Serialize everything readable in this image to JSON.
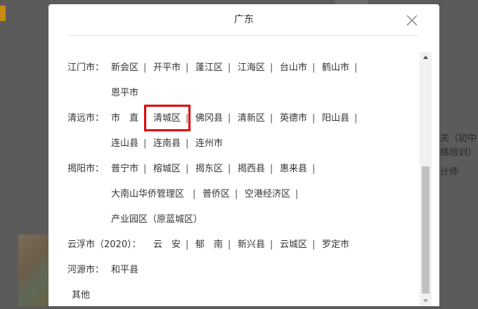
{
  "modal": {
    "title": "广东",
    "close_label": "close"
  },
  "rows": {
    "jiangmen": {
      "city": "江门市：",
      "d1": "新会区",
      "d2": "开平市",
      "d3": "蓬江区",
      "d4": "江海区",
      "d5": "台山市",
      "d6": "鹤山市",
      "d7": "恩平市"
    },
    "qingyuan": {
      "city": "清远市：",
      "d1": "市　直",
      "d2": "清城区",
      "d3": "佛冈县",
      "d4": "清新区",
      "d5": "英德市",
      "d6": "阳山县",
      "d7": "连山县",
      "d8": "连南县",
      "d9": "连州市"
    },
    "jieyang": {
      "city": "揭阳市：",
      "d1": "普宁市",
      "d2": "榕城区",
      "d3": "揭东区",
      "d4": "揭西县",
      "d5": "惠来县",
      "d6": "大南山华侨管理区",
      "d7": "普侨区",
      "d8": "空港经济区",
      "d9": "产业园区（原蓝城区）"
    },
    "yunfu": {
      "city": "云浮市（2020）：",
      "d1": "云　安",
      "d2": "郁　南",
      "d3": "新兴县",
      "d4": "云城区",
      "d5": "罗定市"
    },
    "heyuan": {
      "city": "河源市：",
      "d1": "和平县"
    },
    "other": {
      "label": "其他"
    }
  },
  "separator": "|",
  "background": {
    "text1": "关（初中",
    "text2": "络培训）",
    "text3": "计师"
  },
  "colors": {
    "highlight": "#e00000",
    "overlay": "#5b5b5b"
  }
}
